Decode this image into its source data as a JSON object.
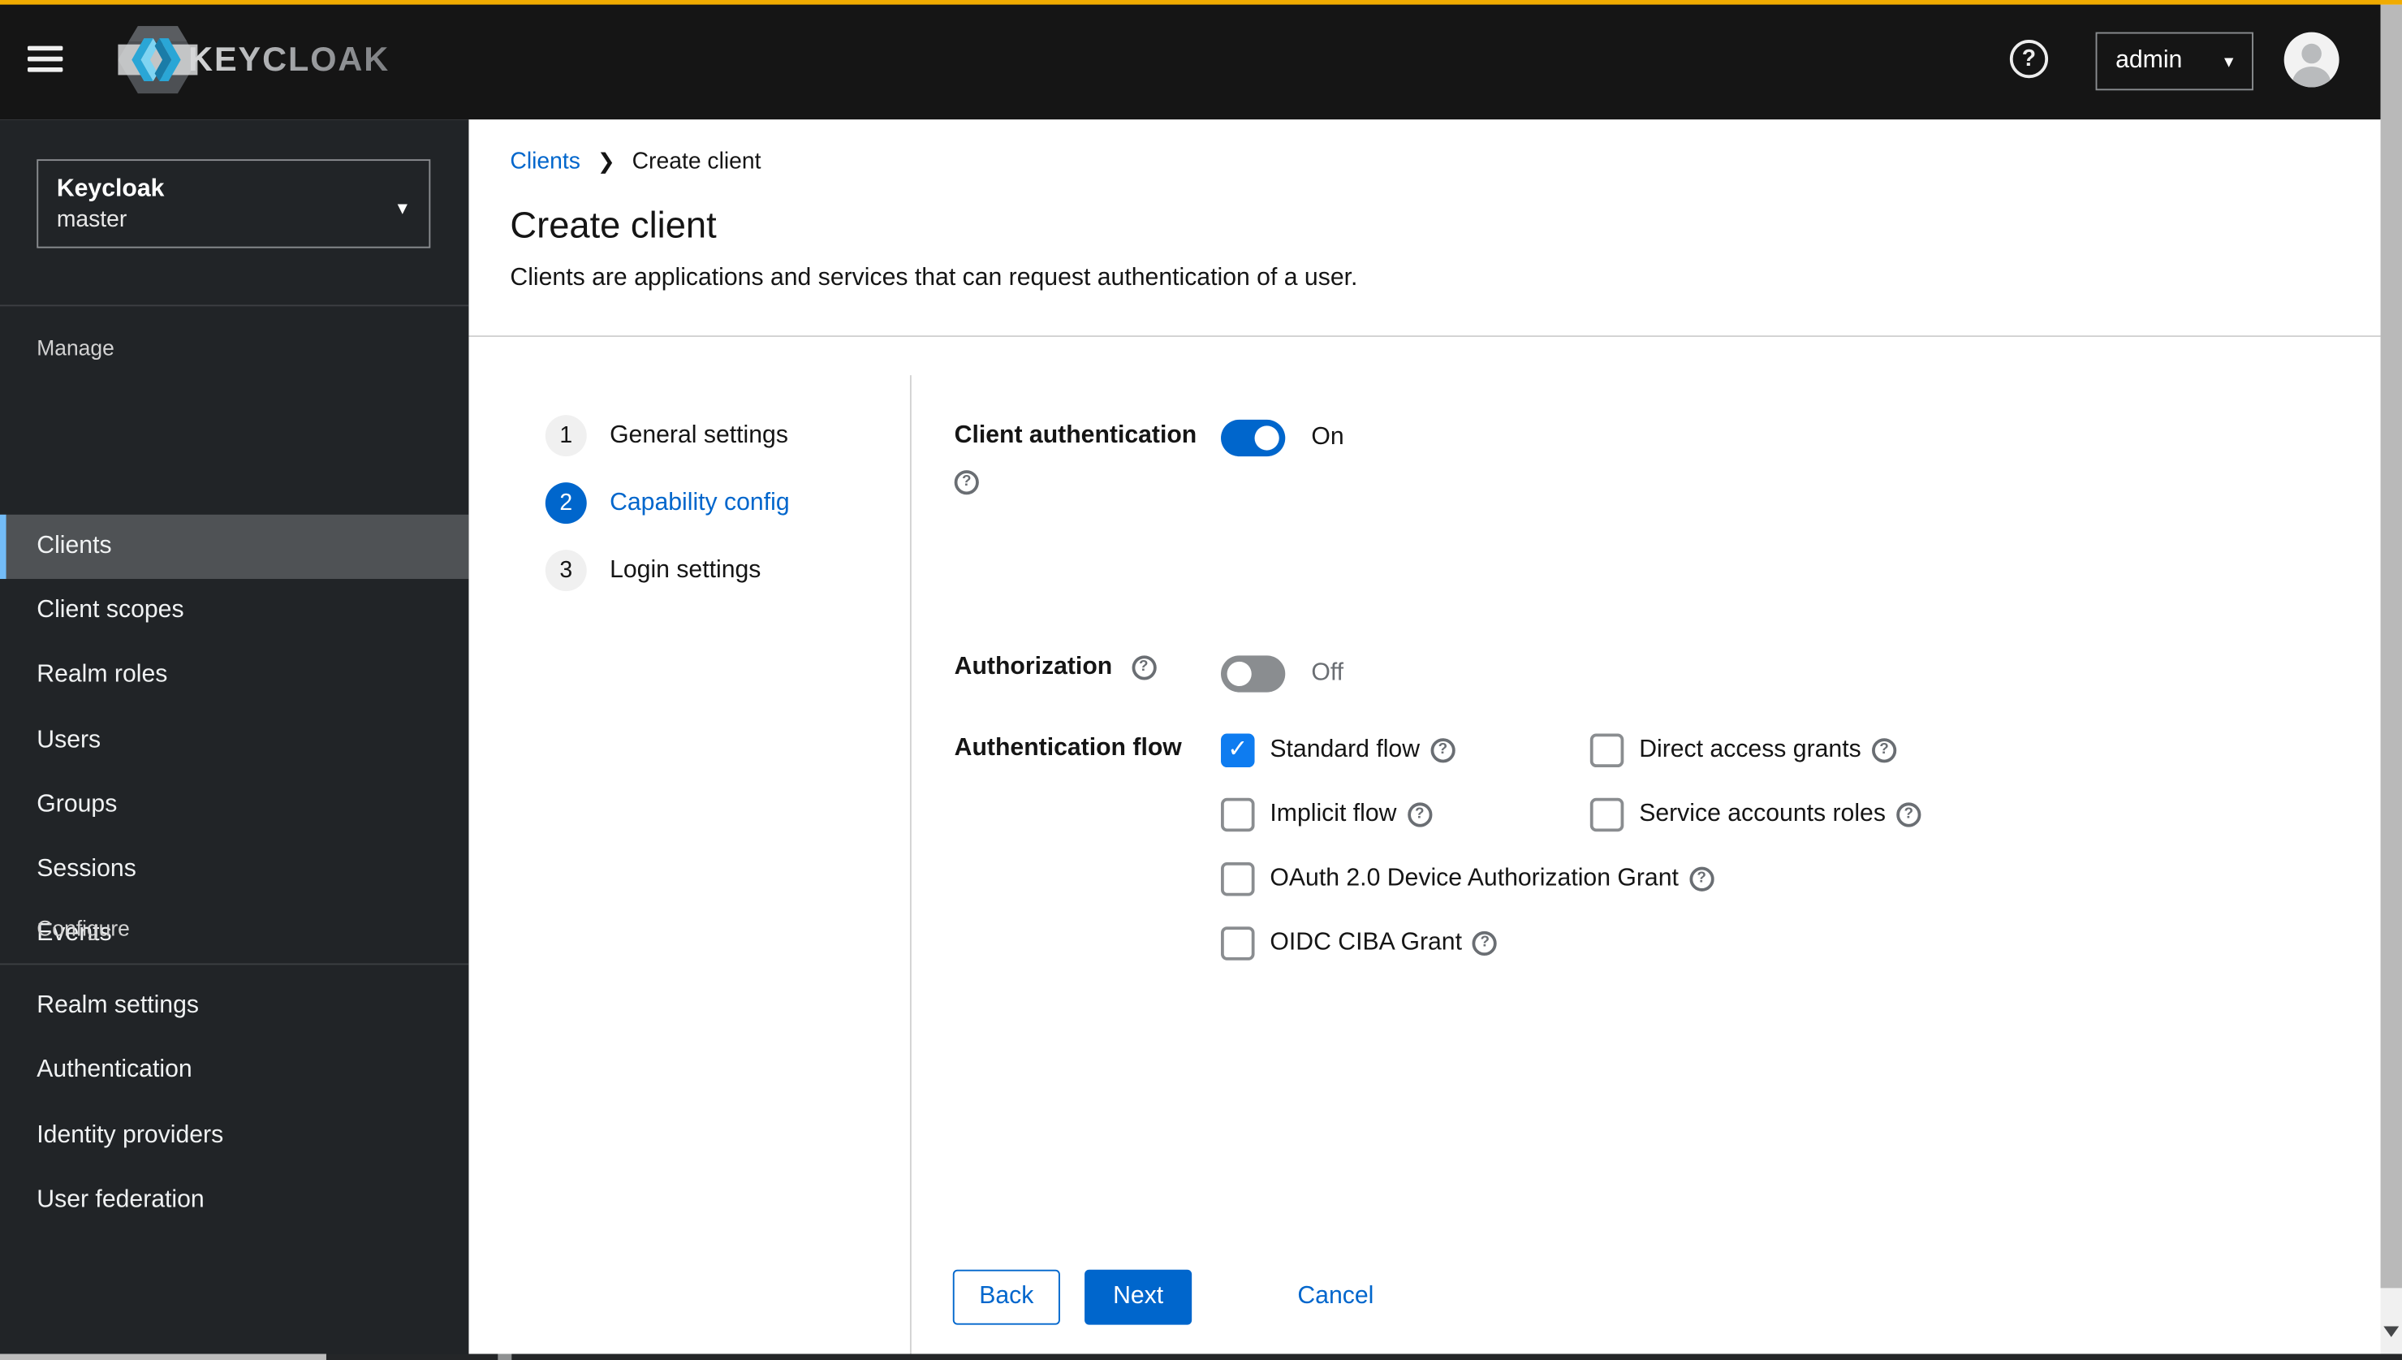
{
  "icons": {
    "help": "?",
    "caret_down": "▾",
    "check": "✓",
    "breadcrumb_sep": "❯"
  },
  "header": {
    "brand": "KEYCLOAK",
    "user": "admin"
  },
  "sidebar": {
    "realm": {
      "name": "Keycloak",
      "current": "master"
    },
    "manage": {
      "label": "Manage",
      "items": [
        {
          "label": "Clients",
          "selected": true
        },
        {
          "label": "Client scopes"
        },
        {
          "label": "Realm roles"
        },
        {
          "label": "Users"
        },
        {
          "label": "Groups"
        },
        {
          "label": "Sessions"
        },
        {
          "label": "Events"
        }
      ]
    },
    "configure": {
      "label": "Configure",
      "items": [
        {
          "label": "Realm settings"
        },
        {
          "label": "Authentication"
        },
        {
          "label": "Identity providers"
        },
        {
          "label": "User federation"
        }
      ]
    }
  },
  "breadcrumb": {
    "parent": "Clients",
    "current": "Create client"
  },
  "page": {
    "title": "Create client",
    "description": "Clients are applications and services that can request authentication of a user."
  },
  "wizard": {
    "active_step": "2",
    "steps": [
      {
        "num": "1",
        "label": "General settings"
      },
      {
        "num": "2",
        "label": "Capability config"
      },
      {
        "num": "3",
        "label": "Login settings"
      }
    ]
  },
  "form": {
    "client_authentication": {
      "label": "Client authentication",
      "state": "On",
      "on": true
    },
    "authorization": {
      "label": "Authorization",
      "state": "Off",
      "on": false
    },
    "authentication_flow": {
      "label": "Authentication flow",
      "col1": [
        {
          "label": "Standard flow",
          "checked": true
        },
        {
          "label": "Implicit flow",
          "checked": false
        },
        {
          "label": "OAuth 2.0 Device Authorization Grant",
          "checked": false
        },
        {
          "label": "OIDC CIBA Grant",
          "checked": false
        }
      ],
      "col2": [
        {
          "label": "Direct access grants",
          "checked": false
        },
        {
          "label": "Service accounts roles",
          "checked": false
        }
      ]
    },
    "actions": {
      "back": "Back",
      "next": "Next",
      "cancel": "Cancel"
    }
  },
  "colors": {
    "accent": "#f0ab00",
    "primary_blue": "#0066cc",
    "checkbox_blue": "#0e7cf0",
    "header_bg": "#151515",
    "sidebar_bg": "#212427",
    "selected_nav_bg": "#4f5255",
    "selected_nav_accent": "#73bcf7",
    "toggle_off": "#8a8d90"
  }
}
